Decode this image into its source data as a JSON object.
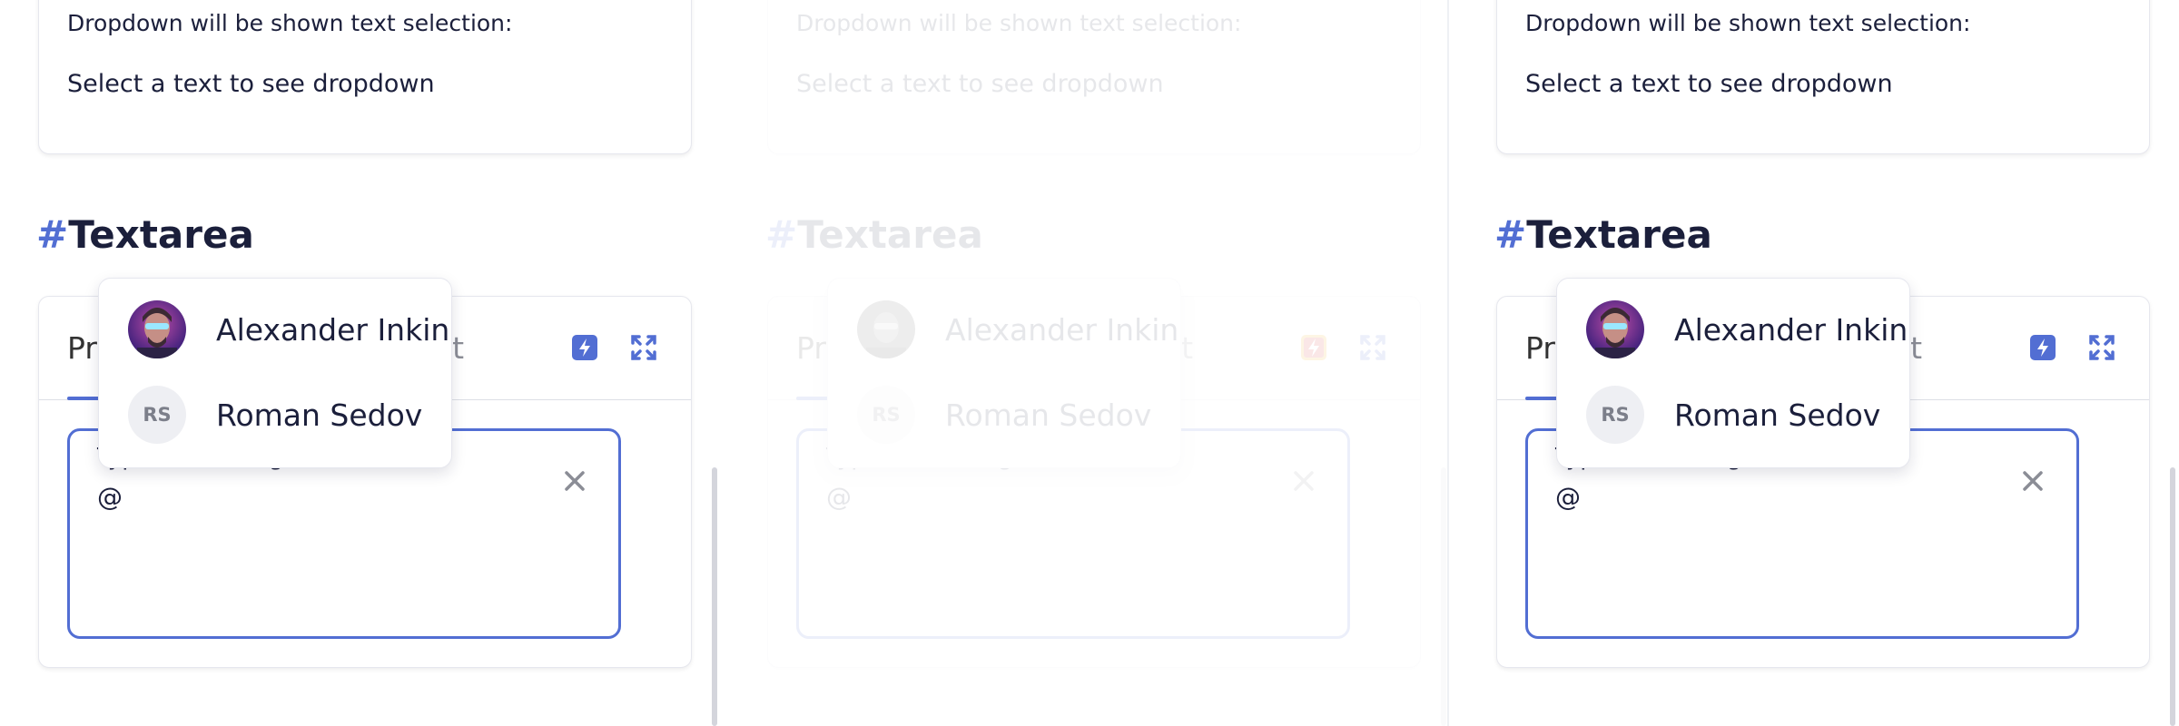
{
  "top_card": {
    "line1": "Dropdown will be shown text selection:",
    "line2": "Select a text to see dropdown"
  },
  "section": {
    "hash": "#",
    "title": "Textarea"
  },
  "tabs": {
    "first_visible": "Pr",
    "second_visible": "ipt"
  },
  "textarea": {
    "hint_visible": "Type something",
    "value": "@"
  },
  "mention_dropdown": {
    "items": [
      {
        "name": "Alexander Inkin",
        "avatar": "photo"
      },
      {
        "name": "Roman Sedov",
        "avatar": "RS"
      }
    ]
  },
  "icons": {
    "bolt": "bolt-icon",
    "expand": "expand-icon",
    "clear": "close-icon"
  },
  "colors": {
    "accent": "#526ed3",
    "text": "#1b1f3b",
    "muted": "#8b8d96"
  }
}
